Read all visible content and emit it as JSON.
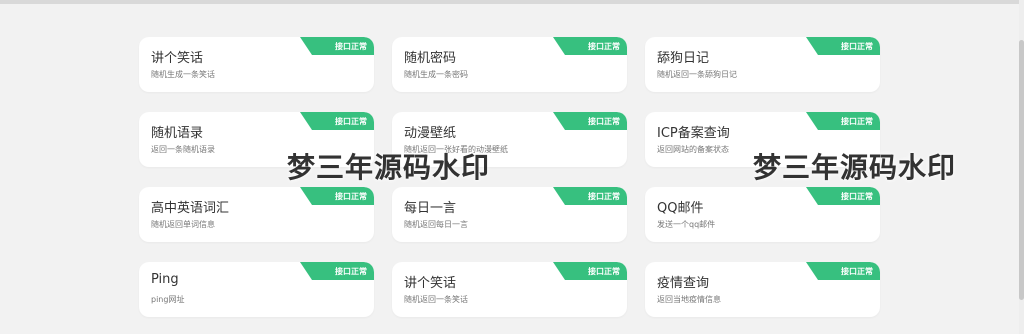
{
  "cards": [
    {
      "title": "讲个笑话",
      "desc": "随机生成一条笑话",
      "badge": "接口正常"
    },
    {
      "title": "随机密码",
      "desc": "随机生成一条密码",
      "badge": "接口正常"
    },
    {
      "title": "舔狗日记",
      "desc": "随机返回一条舔狗日记",
      "badge": "接口正常"
    },
    {
      "title": "随机语录",
      "desc": "返回一条随机语录",
      "badge": "接口正常"
    },
    {
      "title": "动漫壁纸",
      "desc": "随机返回一张好看的动漫壁纸",
      "badge": "接口正常"
    },
    {
      "title": "ICP备案查询",
      "desc": "返回网站的备案状态",
      "badge": "接口正常"
    },
    {
      "title": "高中英语词汇",
      "desc": "随机返回单词信息",
      "badge": "接口正常"
    },
    {
      "title": "每日一言",
      "desc": "随机返回每日一言",
      "badge": "接口正常"
    },
    {
      "title": "QQ邮件",
      "desc": "发送一个qq邮件",
      "badge": "接口正常"
    },
    {
      "title": "Ping",
      "desc": "ping网址",
      "badge": "接口正常"
    },
    {
      "title": "讲个笑话",
      "desc": "随机返回一条笑话",
      "badge": "接口正常"
    },
    {
      "title": "疫情查询",
      "desc": "返回当地疫情信息",
      "badge": "接口正常"
    }
  ],
  "watermark": "梦三年源码水印",
  "colors": {
    "badge": "#37c07f",
    "background": "#f2f2f2",
    "card": "#ffffff"
  }
}
